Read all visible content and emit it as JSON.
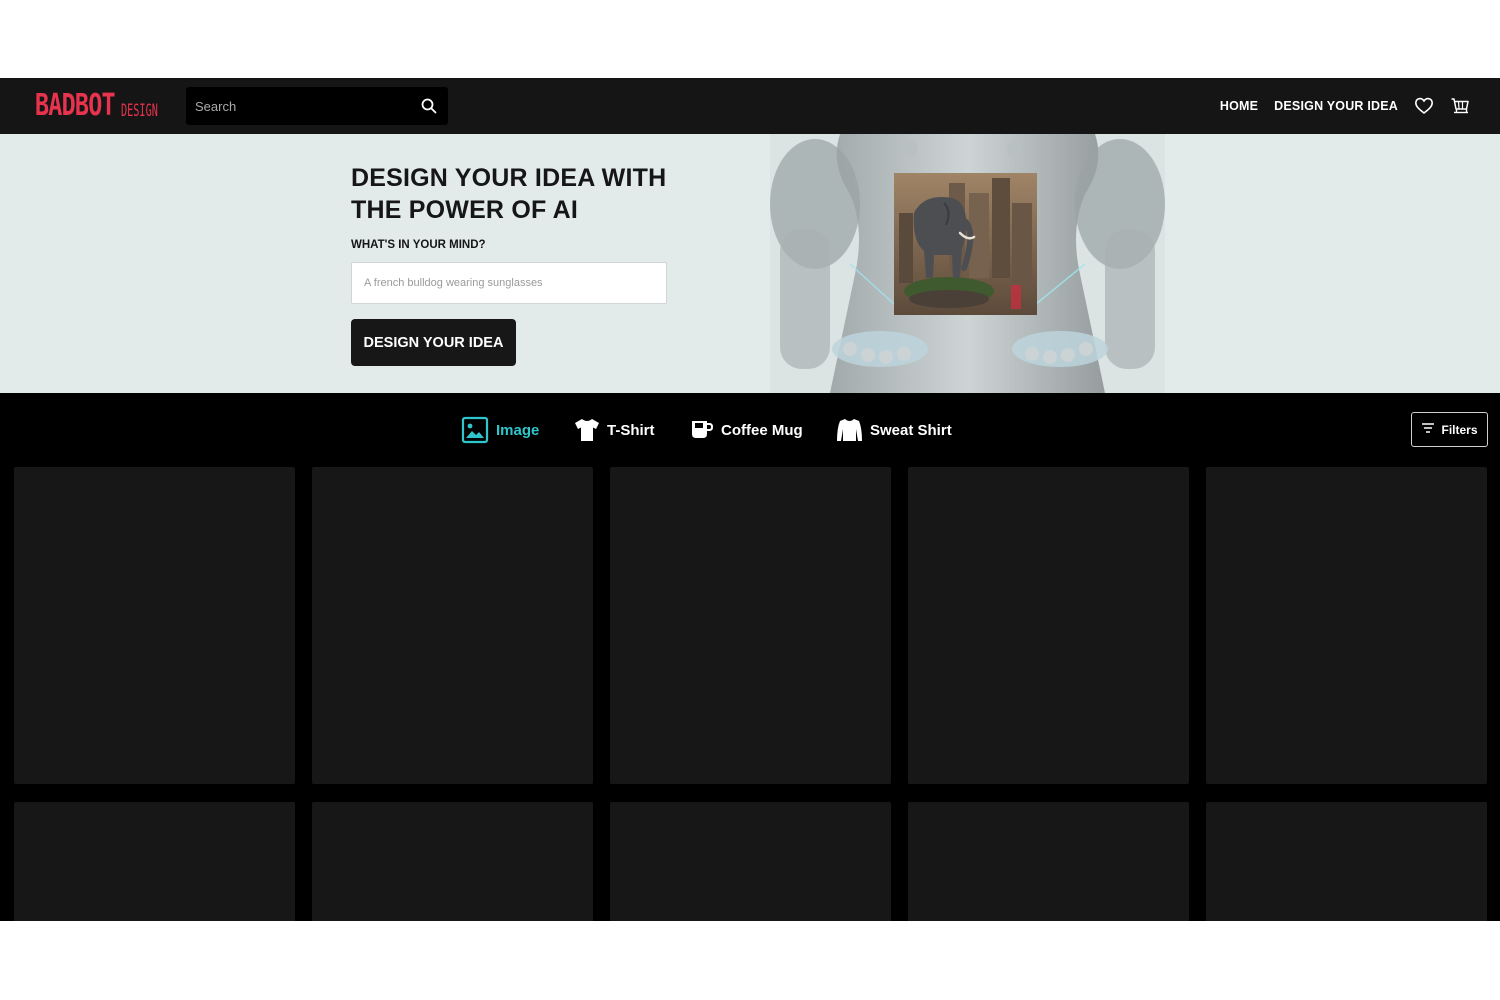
{
  "header": {
    "logo_main": "BADBOT",
    "logo_sub": "DESIGN",
    "search_placeholder": "Search",
    "nav": [
      {
        "label": "HOME"
      },
      {
        "label": "DESIGN YOUR IDEA"
      }
    ],
    "icons": [
      "search-icon",
      "heart-icon",
      "cart-icon"
    ]
  },
  "hero": {
    "title": "DESIGN YOUR IDEA WITH THE POWER OF AI",
    "question": "WHAT'S IN YOUR MIND?",
    "prompt_placeholder": "A french bulldog wearing sunglasses",
    "cta_label": "DESIGN YOUR IDEA"
  },
  "tabs": {
    "items": [
      {
        "label": "Image",
        "icon": "image-icon",
        "active": true
      },
      {
        "label": "T-Shirt",
        "icon": "tshirt-icon",
        "active": false
      },
      {
        "label": "Coffee Mug",
        "icon": "mug-icon",
        "active": false
      },
      {
        "label": "Sweat Shirt",
        "icon": "sweatshirt-icon",
        "active": false
      }
    ],
    "filters_label": "Filters"
  },
  "colors": {
    "brand": "#e8334e",
    "accent": "#2ec6cc",
    "header_bg": "#151515",
    "hero_bg": "#e2eaea",
    "card_bg": "#171717"
  }
}
